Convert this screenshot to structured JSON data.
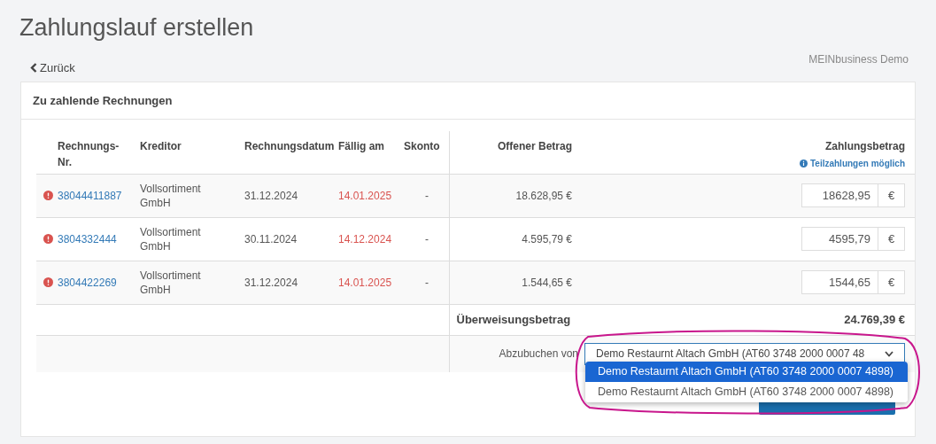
{
  "page": {
    "title": "Zahlungslauf erstellen",
    "back_link": "Zurück",
    "account": "MEINbusiness Demo"
  },
  "card": {
    "title": "Zu zahlende Rechnungen"
  },
  "table": {
    "columns": [
      "Rechnungs-Nr.",
      "Kreditor",
      "Rechnungsdatum",
      "Fällig am",
      "Skonto",
      "Offener Betrag",
      "Zahlungsbetrag"
    ],
    "hint": "Teilzahlungen möglich",
    "rows": [
      {
        "overdue": true,
        "number": "38044411887",
        "creditor": "Vollsortiment GmbH",
        "invoice_date": "31.12.2024",
        "due_date": "14.01.2025",
        "discount": "-",
        "open_amount": "18.628,95 €",
        "payment": "18628,95",
        "currency": "€"
      },
      {
        "overdue": true,
        "number": "3804332444",
        "creditor": "Vollsortiment GmbH",
        "invoice_date": "30.11.2024",
        "due_date": "14.12.2024",
        "discount": "-",
        "open_amount": "4.595,79 €",
        "payment": "4595,79",
        "currency": "€"
      },
      {
        "overdue": true,
        "number": "3804422269",
        "creditor": "Vollsortiment GmbH",
        "invoice_date": "31.12.2024",
        "due_date": "14.01.2025",
        "discount": "-",
        "open_amount": "1.544,65 €",
        "payment": "1544,65",
        "currency": "€"
      }
    ],
    "total_label": "Überweisungsbetrag",
    "total_value": "24.769,39 €",
    "debit_label": "Abzubuchen von",
    "debit_select": {
      "value": "Demo Restaurnt Altach GmbH (AT60 3748 2000 0007 48",
      "expanded": true,
      "options": [
        {
          "label": "Demo Restaurnt Altach GmbH (AT60 3748 2000 0007 4898)",
          "selected": true
        },
        {
          "label": "Demo Restaurnt Altach GmbH (AT60 3748 2000 0007 4898)",
          "selected": false
        }
      ]
    }
  }
}
